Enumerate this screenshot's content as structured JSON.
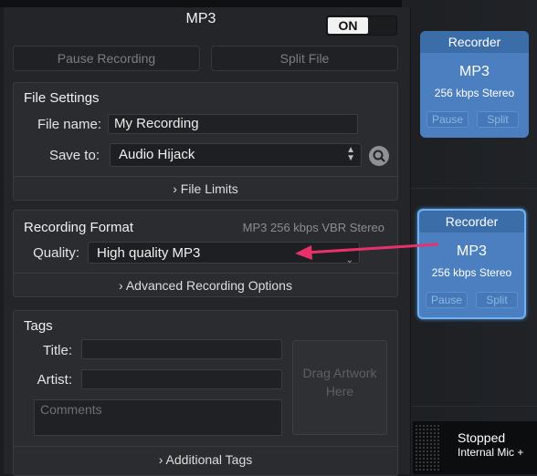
{
  "panel": {
    "title": "MP3",
    "toggle": "ON",
    "pause_button": "Pause Recording",
    "split_button": "Split File"
  },
  "file_settings": {
    "title": "File Settings",
    "file_name_label": "File name:",
    "file_name_value": "My Recording",
    "save_to_label": "Save to:",
    "save_to_value": "Audio Hijack",
    "file_limits": "File Limits"
  },
  "recording_format": {
    "title": "Recording Format",
    "summary": "MP3 256 kbps VBR Stereo",
    "quality_label": "Quality:",
    "quality_value": "High quality MP3",
    "advanced": "Advanced Recording Options"
  },
  "tags": {
    "title": "Tags",
    "title_label": "Title:",
    "artist_label": "Artist:",
    "comments_placeholder": "Comments",
    "artwork": "Drag Artwork Here",
    "additional": "Additional Tags"
  },
  "recorder_blocks": [
    {
      "header": "Recorder",
      "format": "MP3",
      "bitrate": "256 kbps Stereo",
      "pause": "Pause",
      "split": "Split"
    },
    {
      "header": "Recorder",
      "format": "MP3",
      "bitrate": "256 kbps Stereo",
      "pause": "Pause",
      "split": "Split"
    }
  ],
  "status": {
    "state": "Stopped",
    "input": "Internal Mic +"
  },
  "colors": {
    "annotation_arrow": "#e8316b",
    "recorder_blue": "#4b7fbf",
    "recorder_selected_border": "#6fb1f2"
  }
}
